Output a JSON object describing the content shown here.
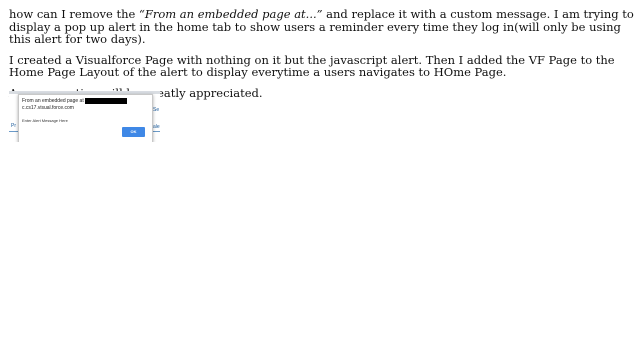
{
  "post": {
    "p1_before": "how can I remove the ",
    "p1_quote": "“From an embedded page at...”",
    "p1_after": " and replace it with a custom message. I am trying to display a pop up alert in the home tab to show users a reminder every time they log in(will only be using this alert for two days).",
    "p2": "I created a Visualforce Page with nothing on it but the javascript alert. Then I added the VF Page to the Home Page Layout of the alert to display everytime a users navigates to HOme Page.",
    "p3": "Any suggestion will be greatly appreciated."
  },
  "screenshot": {
    "dialog_title": "From an embedded page at",
    "dialog_host": "c.cs17.visual.force.com",
    "dialog_message": "Enter Alert Message Here",
    "ok_label": "OK",
    "bg_left_text": "Pr",
    "bg_right_text": "Se",
    "bg_right_text2": "ale",
    "accent_color": "#3f88e6"
  }
}
